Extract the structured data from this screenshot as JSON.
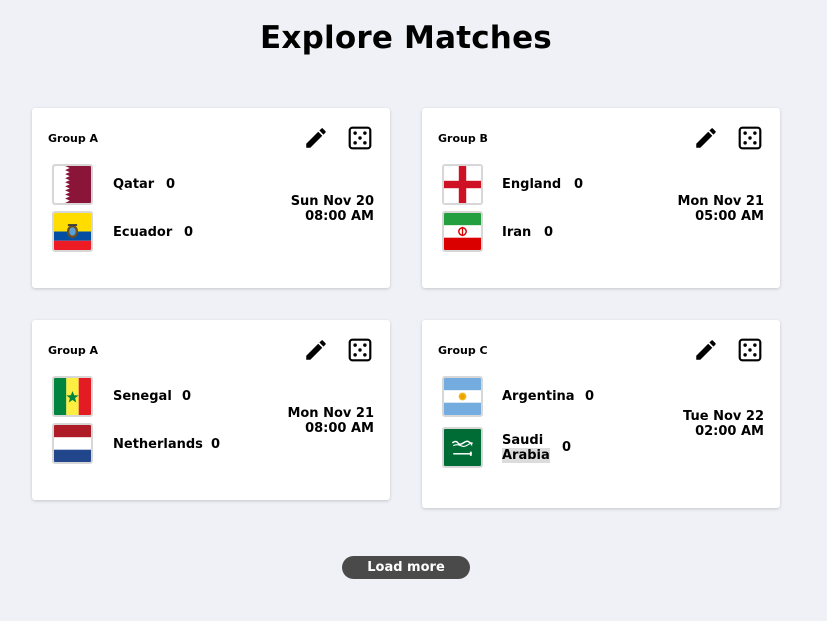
{
  "page": {
    "title": "Explore Matches"
  },
  "matches": [
    {
      "group": "Group A",
      "home": {
        "name": "Qatar",
        "score": "0",
        "flag": "qatar-flag"
      },
      "away": {
        "name": "Ecuador",
        "score": "0",
        "flag": "ecuador-flag"
      },
      "date": "Sun Nov 20",
      "time": "08:00 AM"
    },
    {
      "group": "Group B",
      "home": {
        "name": "England",
        "score": "0",
        "flag": "england-flag"
      },
      "away": {
        "name": "Iran",
        "score": "0",
        "flag": "iran-flag"
      },
      "date": "Mon Nov 21",
      "time": "05:00 AM"
    },
    {
      "group": "Group A",
      "home": {
        "name": "Senegal",
        "score": "0",
        "flag": "senegal-flag"
      },
      "away": {
        "name": "Netherlands",
        "score": "0",
        "flag": "netherlands-flag"
      },
      "date": "Mon Nov 21",
      "time": "08:00 AM"
    },
    {
      "group": "Group C",
      "home": {
        "name": "Argentina",
        "score": "0",
        "flag": "argentina-flag"
      },
      "away": {
        "name_line1": "Saudi",
        "name_line2": "Arabia",
        "score": "0",
        "flag": "saudi-arabia-flag"
      },
      "date": "Tue Nov 22",
      "time": "02:00 AM"
    }
  ],
  "icons": {
    "edit": "pencil-icon",
    "random": "dice-icon"
  },
  "load_more": {
    "label": "Load more"
  },
  "colors": {
    "background": "#f0f1f6",
    "card": "#ffffff",
    "button": "#4a4a4a"
  }
}
